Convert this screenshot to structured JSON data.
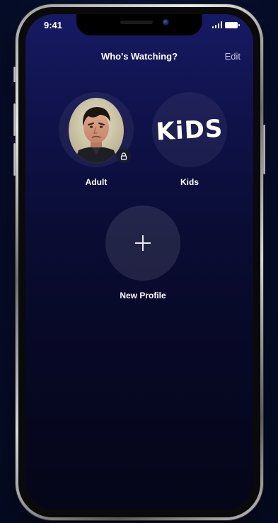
{
  "status_bar": {
    "time": "9:41"
  },
  "header": {
    "title": "Who's Watching?",
    "edit_label": "Edit"
  },
  "profiles": [
    {
      "label": "Adult",
      "icon": "user-photo",
      "locked": true
    },
    {
      "label": "Kids",
      "icon": "kids-logo",
      "logo_text": "KiDS"
    }
  ],
  "new_profile": {
    "label": "New Profile",
    "icon": "plus-icon"
  },
  "colors": {
    "screen_top": "#161a63",
    "screen_bottom": "#050618",
    "text": "#ffffff",
    "edit_text": "#c9cbe0"
  }
}
